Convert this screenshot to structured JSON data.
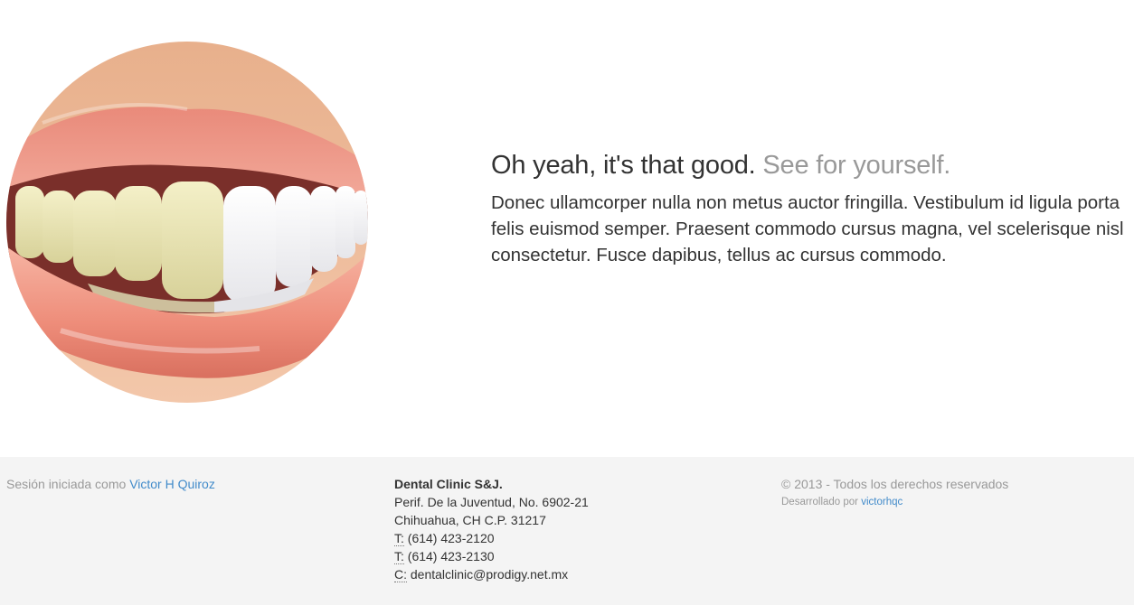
{
  "hero": {
    "image_alt": "Smile with half whitened teeth",
    "heading_main": "Oh yeah, it's that good.",
    "heading_muted": "See for yourself.",
    "lead": "Donec ullamcorper nulla non metus auctor fringilla. Vestibulum id ligula porta felis euismod semper. Praesent commodo cursus magna, vel scelerisque nisl consectetur. Fusce dapibus, tellus ac cursus commodo."
  },
  "footer": {
    "session_prefix": "Sesión iniciada como",
    "session_user": "Victor H Quiroz",
    "clinic_name": "Dental Clinic S&J.",
    "address_line1": "Perif. De la Juventud, No. 6902-21",
    "address_line2": "Chihuahua, CH C.P. 31217",
    "phone1_label": "T:",
    "phone1": "(614) 423-2120",
    "phone2_label": "T:",
    "phone2": "(614) 423-2130",
    "email_label": "C:",
    "email": "dentalclinic@prodigy.net.mx",
    "copyright": "© 2013 - Todos los derechos reservados",
    "developed_prefix": "Desarrollado por",
    "developer": "victorhqc"
  },
  "colors": {
    "link": "#428bca",
    "footer_bg": "#f4f4f4",
    "muted": "#999999"
  }
}
